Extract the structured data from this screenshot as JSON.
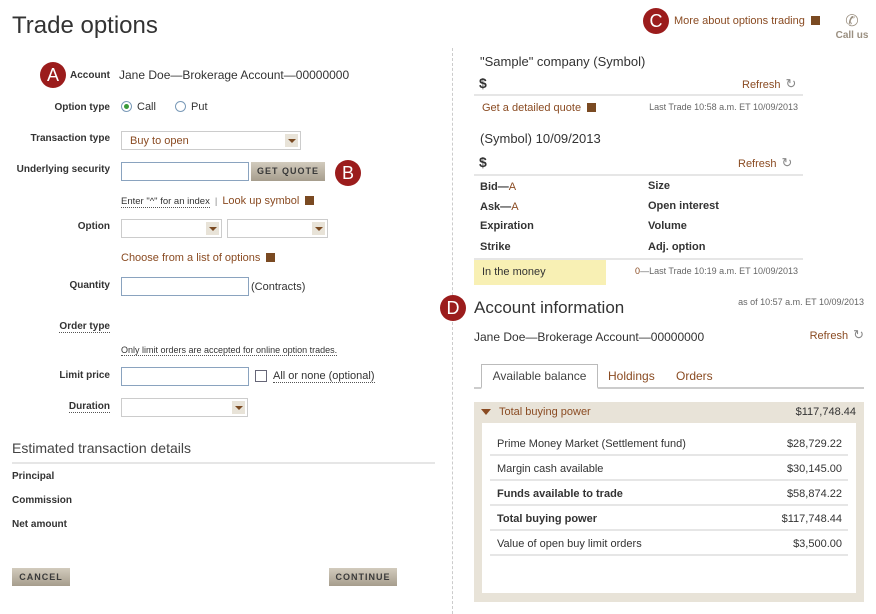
{
  "page": {
    "title": "Trade options",
    "badges": [
      "A",
      "B",
      "C",
      "D"
    ]
  },
  "header": {
    "more_link": "More about options trading",
    "call_us": "Call us"
  },
  "form": {
    "account_label": "Account",
    "account_value": "Jane Doe—Brokerage Account—00000000",
    "option_type_label": "Option type",
    "option_type_options": [
      "Call",
      "Put"
    ],
    "option_type_selected": "Call",
    "transaction_type_label": "Transaction type",
    "transaction_type_value": "Buy to open",
    "underlying_label": "Underlying security",
    "underlying_value": "",
    "get_quote": "GET QUOTE",
    "index_hint": "Enter \"^\" for an index",
    "lookup_link": "Look up symbol",
    "option_label": "Option",
    "choose_link": "Choose from a list of options",
    "quantity_label": "Quantity",
    "quantity_value": "",
    "quantity_unit": "(Contracts)",
    "order_type_label": "Order type",
    "order_note": "Only limit orders are accepted for online option trades.",
    "limit_price_label": "Limit price",
    "limit_price_value": "",
    "all_or_none": "All or none (optional)",
    "all_or_none_checked": false,
    "duration_label": "Duration"
  },
  "estimate": {
    "title": "Estimated transaction details",
    "rows": [
      "Principal",
      "Commission",
      "Net amount"
    ]
  },
  "actions": {
    "cancel": "CANCEL",
    "continue": "CONTINUE"
  },
  "quote": {
    "company": "\"Sample\" company (Symbol)",
    "price": "$",
    "refresh": "Refresh",
    "detailed_link": "Get a detailed quote",
    "last_trade": "Last Trade 10:58 a.m. ET 10/09/2013"
  },
  "option_quote": {
    "title": "(Symbol) 10/09/2013",
    "price": "$",
    "refresh": "Refresh",
    "left": [
      {
        "label": "Bid—",
        "value": "A"
      },
      {
        "label": "Ask—",
        "value": "A"
      },
      {
        "label": "Expiration",
        "value": ""
      },
      {
        "label": "Strike",
        "value": ""
      }
    ],
    "right": [
      "Size",
      "Open interest",
      "Volume",
      "Adj. option"
    ],
    "in_the_money": "In the money",
    "last_trade_prefix": "0",
    "last_trade": "—Last Trade 10:19 a.m. ET 10/09/2013"
  },
  "account_info": {
    "title": "Account information",
    "as_of": "as of 10:57 a.m. ET 10/09/2013",
    "account": "Jane Doe—Brokerage Account—00000000",
    "refresh": "Refresh",
    "tabs": [
      "Available balance",
      "Holdings",
      "Orders"
    ],
    "active_tab": "Available balance",
    "summary_label": "Total buying power",
    "summary_value": "$117,748.44",
    "rows": [
      {
        "label": "Prime Money Market (Settlement fund)",
        "value": "$28,729.22",
        "bold": false
      },
      {
        "label": "Margin cash available",
        "value": "$30,145.00",
        "bold": false
      },
      {
        "label": "Funds available to trade",
        "value": "$58,874.22",
        "bold": true
      },
      {
        "label": "Total buying power",
        "value": "$117,748.44",
        "bold": true
      },
      {
        "label": "Value of open buy limit orders",
        "value": "$3,500.00",
        "bold": false
      }
    ]
  },
  "colors": {
    "accent": "#8a4b22",
    "badge": "#9b1c1c",
    "panel": "#e8e3d8",
    "highlight": "#f8f0b4"
  }
}
